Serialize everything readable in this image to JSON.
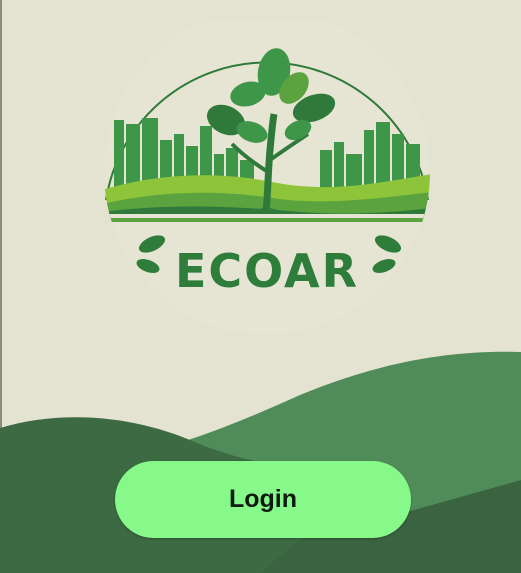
{
  "app": {
    "brand_name": "ECOAR"
  },
  "auth": {
    "login_label": "Login"
  },
  "colors": {
    "background": "#e4e2d0",
    "hill_dark": "#3c6a42",
    "hill_mid": "#4f8c59",
    "button": "#86f98a",
    "brand_green": "#2e7d3a"
  },
  "icons": {
    "logo": "tree-city-logo-icon",
    "leaf": "leaf-icon"
  }
}
